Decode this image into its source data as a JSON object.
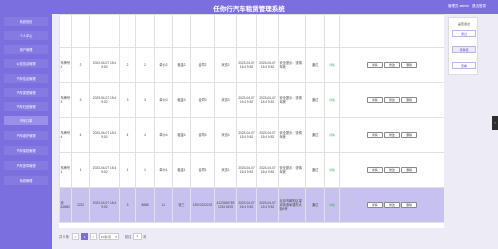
{
  "header": {
    "title": "任你行汽车租赁管理系统",
    "user_label": "管理员 admin",
    "logout": "退出登录"
  },
  "sidebar": {
    "items": [
      {
        "label": "系统首页"
      },
      {
        "label": "个人中心"
      },
      {
        "label": "用户管理"
      },
      {
        "label": "公告信息管理"
      },
      {
        "label": "汽车信息管理"
      },
      {
        "label": "汽车类型管理"
      },
      {
        "label": "汽车归还管理"
      },
      {
        "label": "汽车订单"
      },
      {
        "label": "汽车维护管理"
      },
      {
        "label": "汽车保险管理"
      },
      {
        "label": "汽车违章管理"
      },
      {
        "label": "系统管理"
      }
    ]
  },
  "table": {
    "top_partial": [
      "",
      "",
      "",
      "",
      "",
      "",
      "",
      "",
      "",
      "",
      "",
      "",
      "",
      "",
      "",
      "",
      ""
    ],
    "rows": [
      [
        "车牌号2",
        "2",
        "2023-04-07 15:4 9:52",
        "2",
        "2",
        "单价2",
        "租金2",
        "合同2",
        "状态2",
        "2023-04-07 15:4 9:52",
        "2023-04-07 15:4 9:52",
        "安全提示：谨慎驾驶",
        "通过",
        "详情",
        "详情",
        "修改",
        "删除"
      ],
      [
        "车牌号3",
        "3",
        "2023-04-07 15:4 9:52",
        "3",
        "3",
        "单价3",
        "租金3",
        "合同3",
        "状态3",
        "2023-04-07 15:4 9:52",
        "2023-04-07 15:4 9:52",
        "安全提示：谨慎驾驶",
        "通过",
        "详情",
        "详情",
        "修改",
        "删除"
      ],
      [
        "车牌号4",
        "4",
        "2023-04-07 15:4 9:52",
        "4",
        "4",
        "单价4",
        "租金4",
        "合同4",
        "状态4",
        "2023-04-07 15:4 9:52",
        "2023-04-07 15:4 9:52",
        "安全提示：谨慎驾驶",
        "通过",
        "详情",
        "详情",
        "修改",
        "删除"
      ],
      [
        "车牌号1",
        "1",
        "2023-04-07 15:4 9:52",
        "1",
        "1",
        "单价1",
        "租金1",
        "合同1",
        "状态1",
        "2023-04-07 15:4 9:52",
        "2023-04-07 15:4 9:52",
        "安全提示：谨慎驾驶",
        "通过",
        "详情",
        "详情",
        "修改",
        "删除"
      ],
      [
        "京A26B2",
        "2222",
        "2023-04-07 15:4 9:52",
        "3",
        "8888",
        "11",
        "张三",
        "13922222222",
        "4123456789 1234 5678",
        "2023-04-07 15:4 9:52",
        "2023-04-07 15:4 9:52",
        "北京市朝阳区望京街道阜通东大街6号",
        "通过",
        "详情",
        "详情",
        "修改",
        "删除"
      ]
    ]
  },
  "right_panel": {
    "items": [
      "是否通过",
      "通过",
      "待审核",
      "查看"
    ]
  },
  "side_tab": "›",
  "pager": {
    "total": "共 5 条",
    "prev": "<",
    "page": "1",
    "next": ">",
    "page_size": "10条/页",
    "goto": "前往",
    "goto_value": "1",
    "page_unit": "页"
  }
}
